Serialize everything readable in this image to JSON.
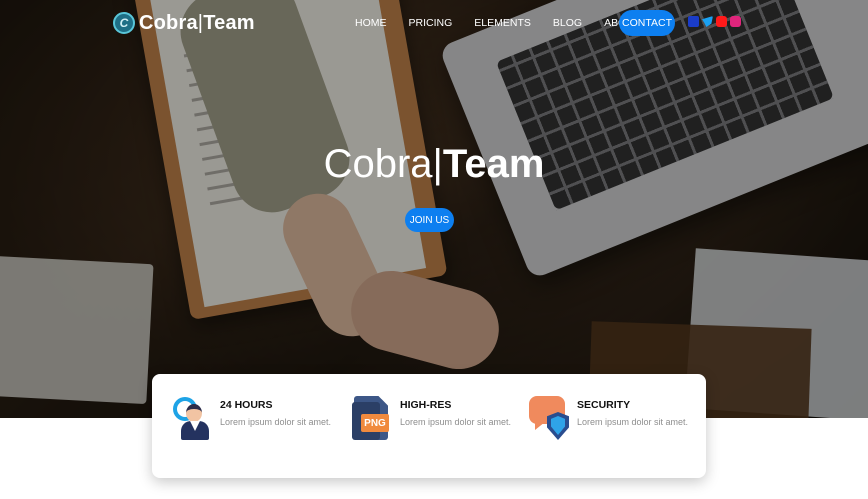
{
  "brand": {
    "logo_letter": "C",
    "name_part1": "Cobra",
    "separator": "|",
    "name_part2": "Team"
  },
  "nav": {
    "items": [
      {
        "label": "HOME"
      },
      {
        "label": "PRICING"
      },
      {
        "label": "ELEMENTS"
      },
      {
        "label": "BLOG"
      },
      {
        "label": "ABOUT"
      }
    ],
    "contact_label": "CONTACT"
  },
  "socials": [
    {
      "icon": "facebook-icon",
      "color": "#1a3cc8"
    },
    {
      "icon": "twitter-icon",
      "color": "#1aa1f2"
    },
    {
      "icon": "youtube-icon",
      "color": "#ff1a1a"
    },
    {
      "icon": "instagram-icon",
      "color": "#e0257c"
    }
  ],
  "hero": {
    "title_part1": "Cobra",
    "title_separator": "|",
    "title_part2": "Team",
    "cta_label": "JOIN US"
  },
  "features": [
    {
      "icon": "support-agent-icon",
      "title": "24 HOURS",
      "description": "Lorem ipsum dolor sit amet."
    },
    {
      "icon": "png-file-icon",
      "title": "HIGH-RES",
      "icon_text": "PNG",
      "description": "Lorem ipsum dolor sit amet."
    },
    {
      "icon": "shield-chat-icon",
      "title": "SECURITY",
      "description": "Lorem ipsum dolor sit amet."
    }
  ],
  "colors": {
    "accent": "#0d7ff0",
    "text_muted": "#8e8e8e"
  }
}
